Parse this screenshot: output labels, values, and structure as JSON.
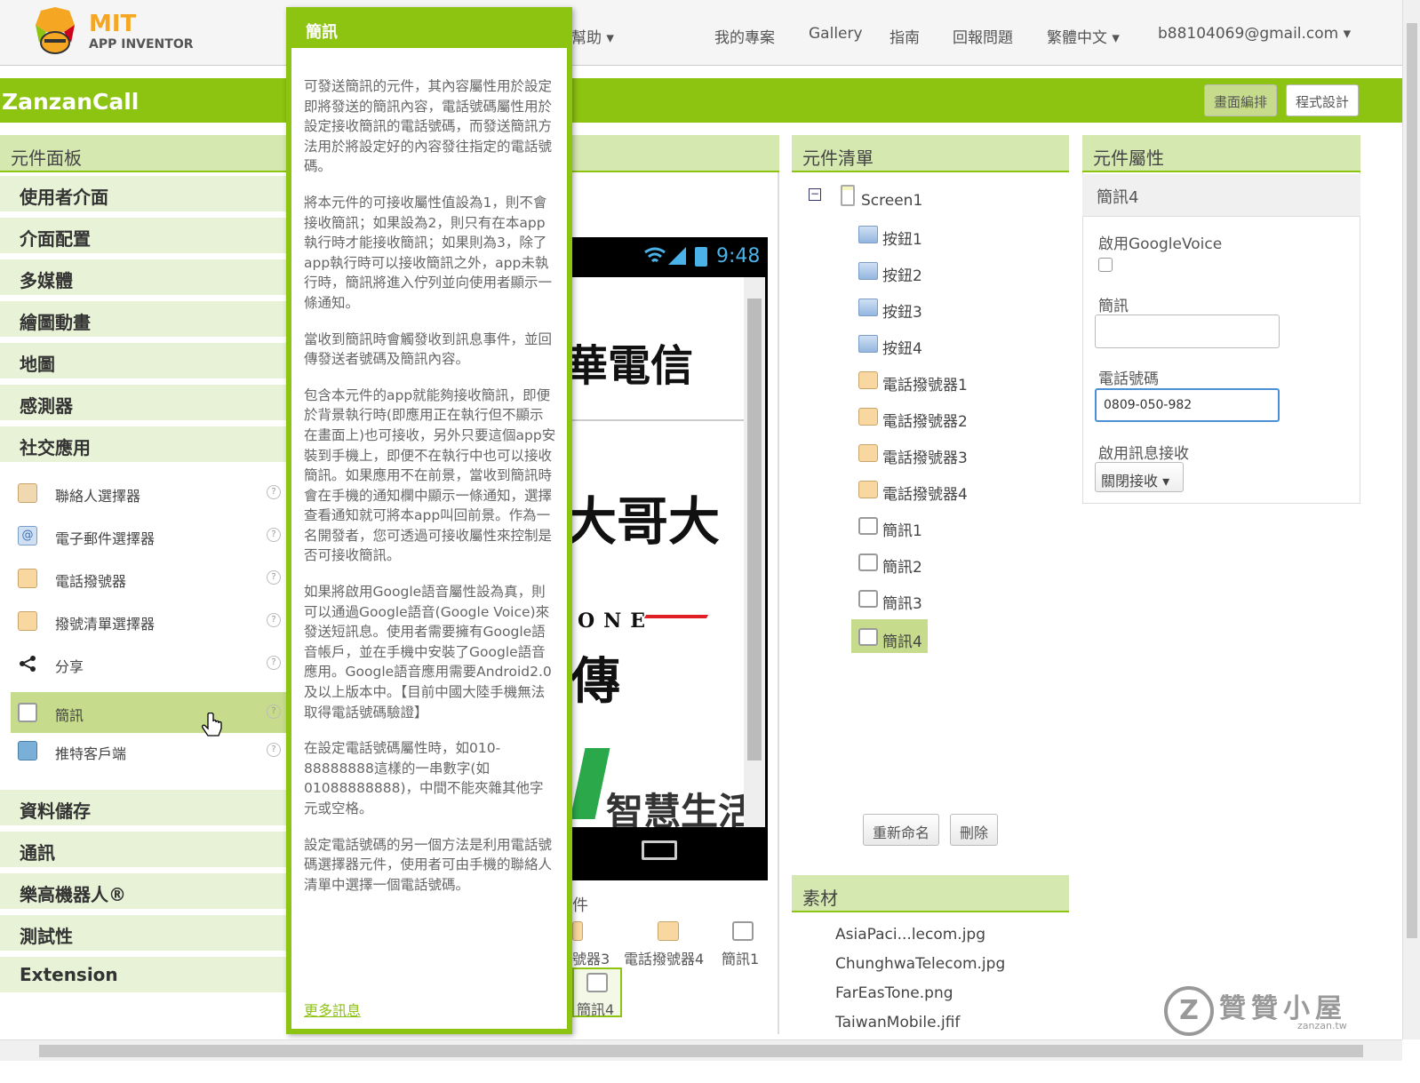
{
  "header": {
    "logo_mit": "MIT",
    "logo_ai": "APP INVENTOR",
    "nav": [
      "幫助 ▾",
      "我的專案",
      "Gallery",
      "指南",
      "回報問題",
      "繁體中文 ▾",
      "b88104069@gmail.com ▾"
    ]
  },
  "project": {
    "name": "ZanzanCall",
    "designer": "畫面編排",
    "blocks": "程式設計"
  },
  "palette": {
    "title": "元件面板",
    "cats_top": [
      "使用者介面",
      "介面配置",
      "多媒體",
      "繪圖動畫",
      "地圖",
      "感測器",
      "社交應用"
    ],
    "items": [
      "聯絡人選擇器",
      "電子郵件選擇器",
      "電話撥號器",
      "撥號清單選擇器",
      "分享",
      "簡訊",
      "推特客戶端"
    ],
    "cats_bottom": [
      "資料儲存",
      "通訊",
      "樂高機器人®",
      "測試性",
      "Extension"
    ]
  },
  "popup": {
    "title": "簡訊",
    "paras": [
      "可發送簡訊的元件，其內容屬性用於設定即將發送的簡訊內容，電話號碼屬性用於設定接收簡訊的電話號碼，而發送簡訊方法用於將設定好的內容發往指定的電話號碼。",
      "將本元件的可接收屬性值設為1，則不會接收簡訊；如果設為2，則只有在本app執行時才能接收簡訊；如果則為3，除了app執行時可以接收簡訊之外，app未執行時，簡訊將進入佇列並向使用者顯示一條通知。",
      "當收到簡訊時會觸發收到訊息事件，並回傳發送者號碼及簡訊內容。",
      "包含本元件的app就能夠接收簡訊，即便於背景執行時(即應用正在執行但不顯示在畫面上)也可接收，另外只要這個app安裝到手機上，即便不在執行中也可以接收簡訊。如果應用不在前景，當收到簡訊時會在手機的通知欄中顯示一條通知，選擇查看通知就可將本app叫回前景。作為一名開發者，您可透過可接收屬性來控制是否可接收簡訊。",
      "如果將啟用Google語音屬性設為真，則可以通過Google語音(Google Voice)來發送短訊息。使用者需要擁有Google語音帳戶，並在手機中安裝了Google語音應用。Google語音應用需要Android2.0及以上版本中。【目前中國大陸手機無法取得電話號碼驗證】",
      "在設定電話號碼屬性時，如010-88888888這樣的一串數字(如01088888888)，中間不能夾雜其他字元或空格。",
      "設定電話號碼的另一個方法是利用電話號碼選擇器元件，使用者可由手機的聯絡人清單中選擇一個電話號碼。"
    ],
    "more": "更多訊息"
  },
  "viewer": {
    "time": "9:48",
    "logos": [
      "華電信",
      "大哥大",
      "ONE",
      "傳",
      "智慧生活"
    ],
    "nonvisible_title": "件",
    "nonvisible": [
      "號器3",
      "電話撥號器4",
      "簡訊1",
      "簡訊4"
    ]
  },
  "components": {
    "title": "元件清單",
    "root": "Screen1",
    "items": [
      "按鈕1",
      "按鈕2",
      "按鈕3",
      "按鈕4",
      "電話撥號器1",
      "電話撥號器2",
      "電話撥號器3",
      "電話撥號器4",
      "簡訊1",
      "簡訊2",
      "簡訊3",
      "簡訊4"
    ],
    "rename": "重新命名",
    "delete": "刪除"
  },
  "assets": {
    "title": "素材",
    "files": [
      "AsiaPaci...lecom.jpg",
      "ChunghwaTelecom.jpg",
      "FarEasTone.png",
      "TaiwanMobile.jfif"
    ]
  },
  "properties": {
    "title": "元件屬性",
    "component": "簡訊4",
    "google_voice_label": "啟用GoogleVoice",
    "google_voice": false,
    "message_label": "簡訊",
    "message": "",
    "phone_label": "電話號碼",
    "phone": "0809-050-982",
    "receiving_label": "啟用訊息接收",
    "receiving": "關閉接收 ▾"
  },
  "watermark": {
    "text": "贊贊小屋",
    "url": "zanzan.tw"
  },
  "colors": {
    "accent": "#8dc311",
    "accent_light": "#e8f2d6"
  }
}
